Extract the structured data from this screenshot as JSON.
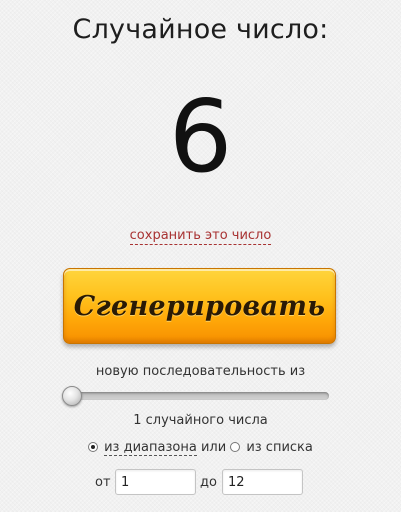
{
  "header": {
    "title": "Случайное число:"
  },
  "result": {
    "number": "6",
    "save_link": "сохранить это число"
  },
  "generate": {
    "button_label": "Сгенерировать"
  },
  "sequence": {
    "label": "новую последовательность из",
    "slider_level": 0,
    "count_text": "1 случайного числа"
  },
  "mode": {
    "options": [
      {
        "label": "из диапазона",
        "selected": true
      },
      {
        "label": "из списка",
        "selected": false
      }
    ],
    "connector": "или"
  },
  "range": {
    "from_label": "от",
    "from_value": "1",
    "to_label": "до",
    "to_value": "12"
  },
  "colors": {
    "link": "#a83232",
    "button_top": "#ffd53d",
    "button_bottom": "#f78f00"
  }
}
